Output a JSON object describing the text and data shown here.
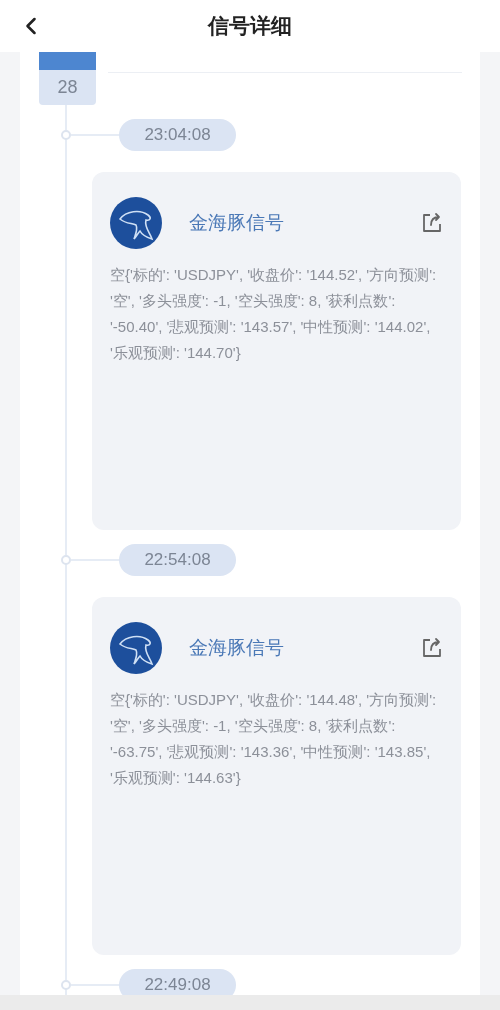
{
  "header": {
    "title": "信号详细"
  },
  "date_badge": {
    "day": "28"
  },
  "entries": [
    {
      "time": "23:04:08",
      "card": {
        "source": "金海豚信号",
        "message": "空{'标的': 'USDJPY', '收盘价': '144.52', '方向预测': '空', '多头强度': -1, '空头强度': 8, '获利点数': '-50.40', '悲观预测': '143.57', '中性预测': '144.02', '乐观预测': '144.70'}"
      }
    },
    {
      "time": "22:54:08",
      "card": {
        "source": "金海豚信号",
        "message": "空{'标的': 'USDJPY', '收盘价': '144.48', '方向预测': '空', '多头强度': -1, '空头强度': 8, '获利点数': '-63.75', '悲观预测': '143.36', '中性预测': '143.85', '乐观预测': '144.63'}"
      }
    },
    {
      "time": "22:49:08"
    }
  ]
}
